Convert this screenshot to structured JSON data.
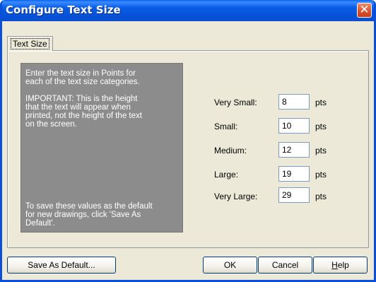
{
  "window": {
    "title": "Configure Text Size"
  },
  "title_buttons": {
    "close_glyph": "✕",
    "close_icon": "close-icon"
  },
  "tabs": [
    {
      "label": "Text Size"
    }
  ],
  "info": {
    "paragraph1": "Enter the text size in Points for\neach of the text size categories.",
    "paragraph2": "IMPORTANT: This is the height\nthat the text will appear when\nprinted, not the height of the text\non the screen.",
    "paragraph3": "To save these values as the default\nfor new drawings, click 'Save As\nDefault'."
  },
  "sizes": [
    {
      "label": "Very Small:",
      "value": "8",
      "unit": "pts"
    },
    {
      "label": "Small:",
      "value": "10",
      "unit": "pts"
    },
    {
      "label": "Medium:",
      "value": "12",
      "unit": "pts"
    },
    {
      "label": "Large:",
      "value": "19",
      "unit": "pts"
    },
    {
      "label": "Very Large:",
      "value": "29",
      "unit": "pts"
    }
  ],
  "buttons": {
    "save_default": "Save As Default...",
    "ok": "OK",
    "cancel": "Cancel",
    "help_prefix": "",
    "help_mnemonic": "H",
    "help_rest": "elp"
  },
  "colors": {
    "title_bar": "#0a5ee6",
    "close_button": "#d9502e",
    "dialog_bg": "#ece9d8",
    "info_box_bg": "#8c8c8c"
  }
}
